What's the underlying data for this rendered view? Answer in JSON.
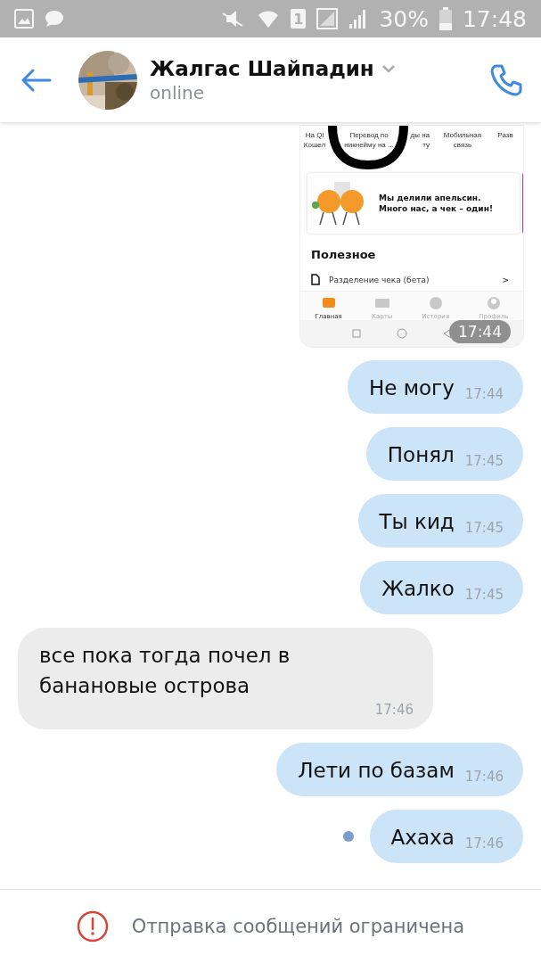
{
  "status_bar": {
    "sim_slot": "1",
    "battery": "30%",
    "time": "17:48"
  },
  "header": {
    "name": "Жалгас Шайпадин",
    "status": "online"
  },
  "messages": [
    {
      "outgoing": true,
      "time": "17:44",
      "screenshot": {
        "shortcuts": [
          [
            "На Ql",
            "Кошел"
          ],
          [
            "Перевод по",
            "никнейму на ..."
          ],
          [
            "ды на",
            "ту"
          ],
          [
            "Мобильная",
            "связь"
          ],
          [
            "Разв"
          ]
        ],
        "promo": "Мы делили апельсин. Много нас, а чек – один!",
        "section": "Полезное",
        "row": "Разделение чека (бета)",
        "row_arrow": ">",
        "tabs": [
          {
            "label": "Главная",
            "selected": true
          },
          {
            "label": "Карты",
            "selected": false
          },
          {
            "label": "История",
            "selected": false
          },
          {
            "label": "Профиль",
            "selected": false
          }
        ]
      }
    },
    {
      "kind": "text",
      "outgoing": true,
      "text": "Не могу",
      "time": "17:44",
      "unread": false
    },
    {
      "kind": "text",
      "outgoing": true,
      "text": "Понял",
      "time": "17:45",
      "unread": false
    },
    {
      "kind": "text",
      "outgoing": true,
      "text": "Ты кид",
      "time": "17:45",
      "unread": false
    },
    {
      "kind": "text",
      "outgoing": true,
      "text": "Жалко",
      "time": "17:45",
      "unread": false
    },
    {
      "kind": "text",
      "outgoing": false,
      "text": "все пока тогда почел в банановые острова",
      "time": "17:46",
      "unread": false
    },
    {
      "kind": "text",
      "outgoing": true,
      "text": "Лети по базам",
      "time": "17:46",
      "unread": false
    },
    {
      "kind": "text",
      "outgoing": true,
      "text": "Ахаха",
      "time": "17:46",
      "unread": true
    }
  ],
  "footer": {
    "notice": "Отправка сообщений ограничена"
  }
}
